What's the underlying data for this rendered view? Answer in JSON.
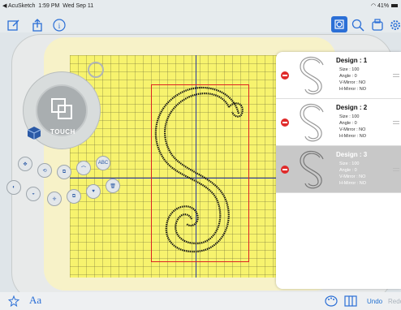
{
  "statusbar": {
    "back_app": "◀ AcuSketch",
    "time": "1:59 PM",
    "date": "Wed Sep 11",
    "battery": "41%"
  },
  "dial": {
    "label": "TOUCH"
  },
  "tools": {
    "abc_label": "ABC"
  },
  "designs": [
    {
      "title": "Design : 1",
      "size": "Size : 100",
      "angle": "Angle : 0",
      "vmirror": "V-Mirror : NO",
      "hmirror": "H-Mirror : NO"
    },
    {
      "title": "Design : 2",
      "size": "Size : 100",
      "angle": "Angle : 0",
      "vmirror": "V-Mirror : NO",
      "hmirror": "H-Mirror : NO"
    },
    {
      "title": "Design : 3",
      "size": "Size : 100",
      "angle": "Angle : 0",
      "vmirror": "V-Mirror : NO",
      "hmirror": "H-Mirror : NO"
    }
  ],
  "bottom": {
    "text_tool": "Aa",
    "undo": "Undo",
    "redo": "Redo"
  },
  "colors": {
    "accent": "#1f6fd0",
    "grid": "#f7f36e",
    "selection": "#d22222",
    "delete": "#e02a2a"
  }
}
